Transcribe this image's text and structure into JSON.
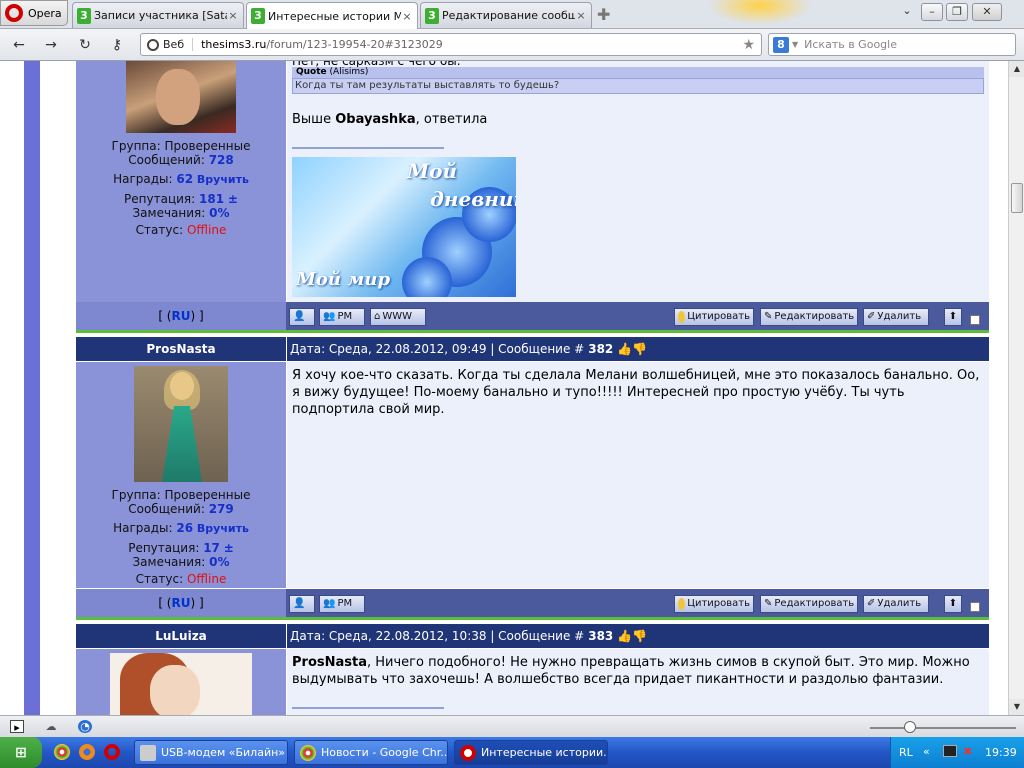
{
  "browser": {
    "menu_label": "Opera",
    "tabs": [
      {
        "label": "Записи участника [Sata...",
        "icon": "3"
      },
      {
        "label": "Интересные истории М...",
        "icon": "3"
      },
      {
        "label": "Редактирование сообщ...",
        "icon": "3"
      }
    ],
    "address": {
      "badge": "Веб",
      "domain": "thesims3.ru",
      "path": "/forum/123-19954-20#3123029"
    },
    "search": {
      "engine": "8",
      "placeholder": "Искать в Google"
    }
  },
  "posts": [
    {
      "partial": true,
      "group": "Группа: Проверенные",
      "messages_label": "Сообщений:",
      "messages": "728",
      "awards_label": "Награды:",
      "awards": "62",
      "award_link": "Вручить",
      "rep_label": "Репутация:",
      "rep": "181",
      "rep_pm": "±",
      "warn_label": "Замечания:",
      "warn": "0%",
      "status_label": "Статус:",
      "status": "Offline",
      "top_line": "Нет, не сарказм с чего бы.",
      "quote_head": "Quote",
      "quote_author": "(Alisims)",
      "quote_text": "Когда ты там результаты выставлять то будешь?",
      "reply_prefix": "Выше ",
      "reply_name": "Obayashka",
      "reply_suffix": ", ответила",
      "signature": {
        "line1": "Мой",
        "line2": "дневник",
        "line3": "Мой мир"
      },
      "ru_open": "[ (",
      "ru": "RU",
      "ru_close": ") ]",
      "btn_pm": "PM",
      "btn_www": "WWW",
      "btn_quote": "Цитировать",
      "btn_edit": "Редактировать",
      "btn_delete": "Удалить"
    },
    {
      "username": "ProsNasta",
      "date": "Дата: Среда, 22.08.2012, 09:49 | Сообщение #",
      "number": "382",
      "group": "Группа: Проверенные",
      "messages_label": "Сообщений:",
      "messages": "279",
      "awards_label": "Награды:",
      "awards": "26",
      "award_link": "Вручить",
      "rep_label": "Репутация:",
      "rep": "17",
      "rep_pm": "±",
      "warn_label": "Замечания:",
      "warn": "0%",
      "status_label": "Статус:",
      "status": "Offline",
      "text": "Я хочу кое-что сказать. Когда ты сделала Мелани волшебницей, мне это показалось банально. Оо, я вижу будущее! По-моему банально и тупо!!!!! Интересней про простую учёбу. Ты чуть подпортила свой мир.",
      "ru_open": "[ (",
      "ru": "RU",
      "ru_close": ") ]",
      "btn_pm": "PM",
      "btn_quote": "Цитировать",
      "btn_edit": "Редактировать",
      "btn_delete": "Удалить"
    },
    {
      "username": "LuLuiza",
      "date": "Дата: Среда, 22.08.2012, 10:38 | Сообщение #",
      "number": "383",
      "reply_name": "ProsNasta",
      "text": ", Ничего подобного! Не нужно превращать жизнь симов в скупой быт. Это мир. Можно выдумывать что захочешь! А волшебство всегда придает пикантности и раздолью фантазии."
    }
  ],
  "taskbar": {
    "start": "пуск",
    "tasks": [
      {
        "label": "USB-модем «Билайн»"
      },
      {
        "label": "Новости - Google Chr..."
      },
      {
        "label": "Интересные истории..."
      }
    ],
    "lang": "RL",
    "time": "19:39"
  },
  "colors": {
    "accent": "#1f3577",
    "user_panel": "#8a93d8",
    "green_divider": "#5bbd3a"
  }
}
